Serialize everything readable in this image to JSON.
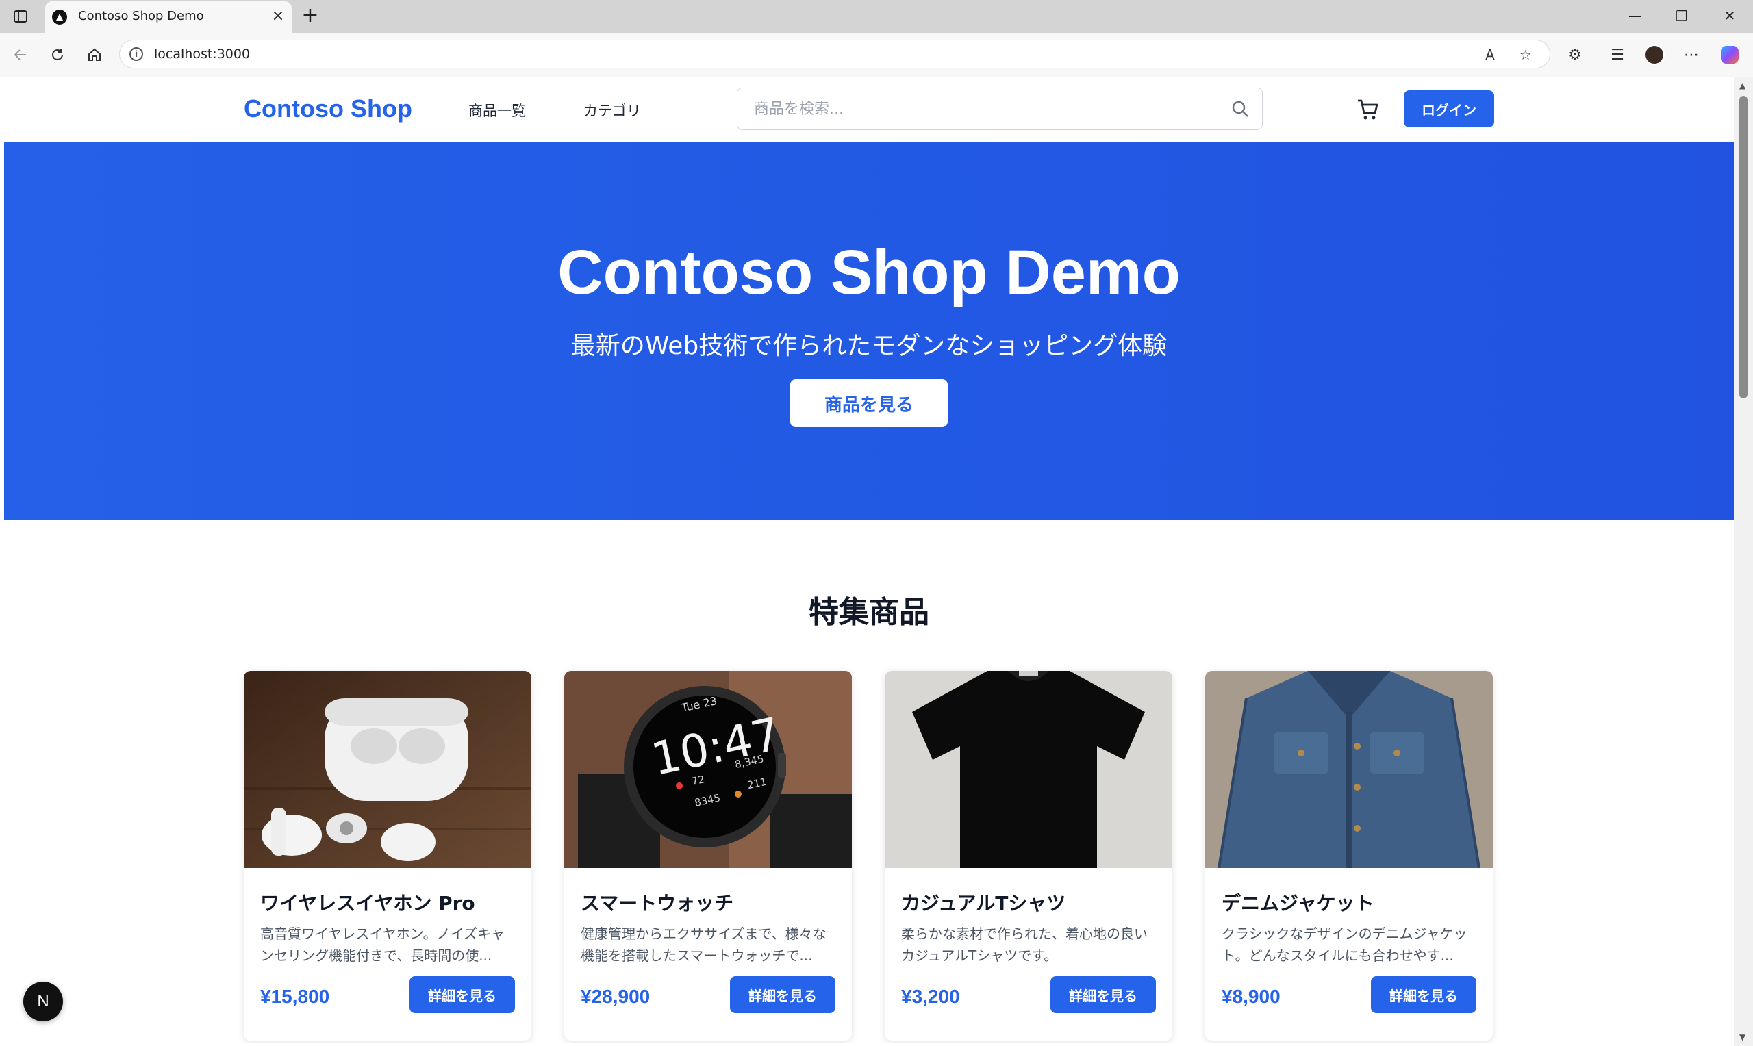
{
  "browser": {
    "tab_title": "Contoso Shop Demo",
    "url": "localhost:3000",
    "new_tab_label": "+",
    "close_tab_label": "×"
  },
  "header": {
    "logo": "Contoso Shop",
    "nav": [
      "商品一覧",
      "カテゴリ"
    ],
    "search_placeholder": "商品を検索...",
    "login_label": "ログイン"
  },
  "hero": {
    "title": "Contoso Shop Demo",
    "subtitle": "最新のWeb技術で作られたモダンなショッピング体験",
    "cta_label": "商品を見る"
  },
  "featured": {
    "title": "特集商品",
    "products": [
      {
        "name": "ワイヤレスイヤホン Pro",
        "description": "高音質ワイヤレスイヤホン。ノイズキャンセリング機能付きで、長時間の使...",
        "price": "¥15,800",
        "button": "詳細を見る",
        "image": "earbuds"
      },
      {
        "name": "スマートウォッチ",
        "description": "健康管理からエクササイズまで、様々な機能を搭載したスマートウォッチで...",
        "price": "¥28,900",
        "button": "詳細を見る",
        "image": "smartwatch",
        "watch_day": "Tue 23",
        "watch_time": "10:47",
        "watch_stats": [
          "72",
          "8,345",
          "8345",
          "211"
        ]
      },
      {
        "name": "カジュアルTシャツ",
        "description": "柔らかな素材で作られた、着心地の良いカジュアルTシャツです。",
        "price": "¥3,200",
        "button": "詳細を見る",
        "image": "tshirt"
      },
      {
        "name": "デニムジャケット",
        "description": "クラシックなデザインのデニムジャケット。どんなスタイルにも合わせやす...",
        "price": "¥8,900",
        "button": "詳細を見る",
        "image": "denim-jacket"
      }
    ]
  },
  "devtools_badge": "N",
  "colors": {
    "brand": "#2563eb",
    "hero_bg": "#2357e4"
  }
}
